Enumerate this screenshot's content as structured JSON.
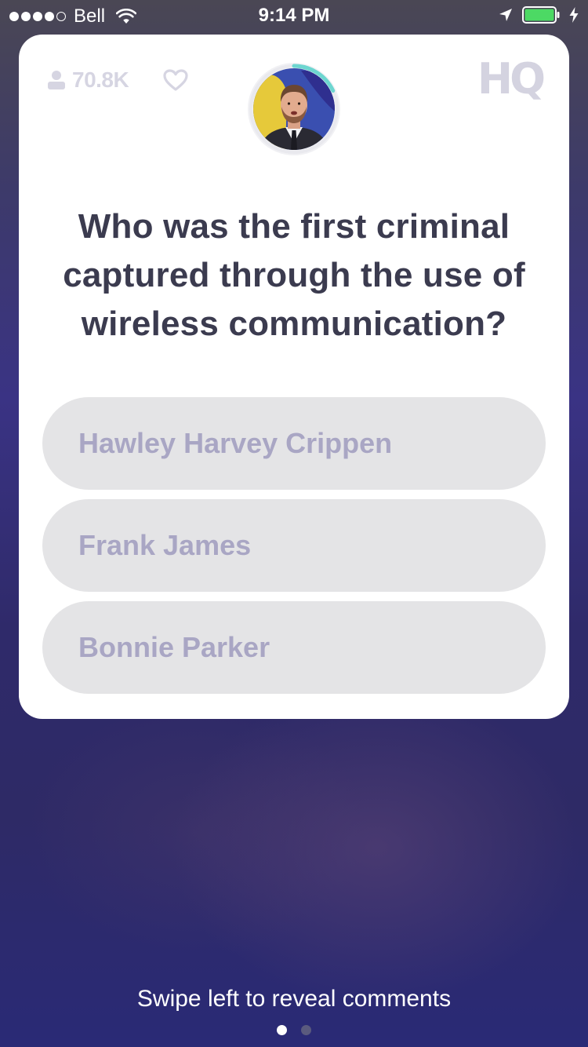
{
  "status_bar": {
    "carrier": "Bell",
    "signal_bars_filled": 4,
    "signal_bars_total": 5,
    "time": "9:14 PM",
    "battery_level": 1.0,
    "charging": true,
    "icons": [
      "wifi-icon",
      "location-arrow-icon",
      "battery-icon",
      "charging-bolt-icon"
    ]
  },
  "game": {
    "viewer_count": "70.8K",
    "logo": "HQ",
    "timer_fraction_remaining": 0.18,
    "question": "Who was the first criminal captured through the use of wireless communication?",
    "answers": [
      {
        "label": "Hawley Harvey Crippen"
      },
      {
        "label": "Frank James"
      },
      {
        "label": "Bonnie Parker"
      }
    ]
  },
  "footer": {
    "hint": "Swipe left to reveal comments",
    "pages_total": 2,
    "active_page": 1
  },
  "colors": {
    "card_background": "#ffffff",
    "question_text": "#3b3b4f",
    "answer_background": "#e4e4e6",
    "answer_text": "#a9a6c4",
    "muted_header": "#d6d5e2",
    "timer_arc": "#6dd6d0",
    "battery_fill": "#4cd964"
  }
}
